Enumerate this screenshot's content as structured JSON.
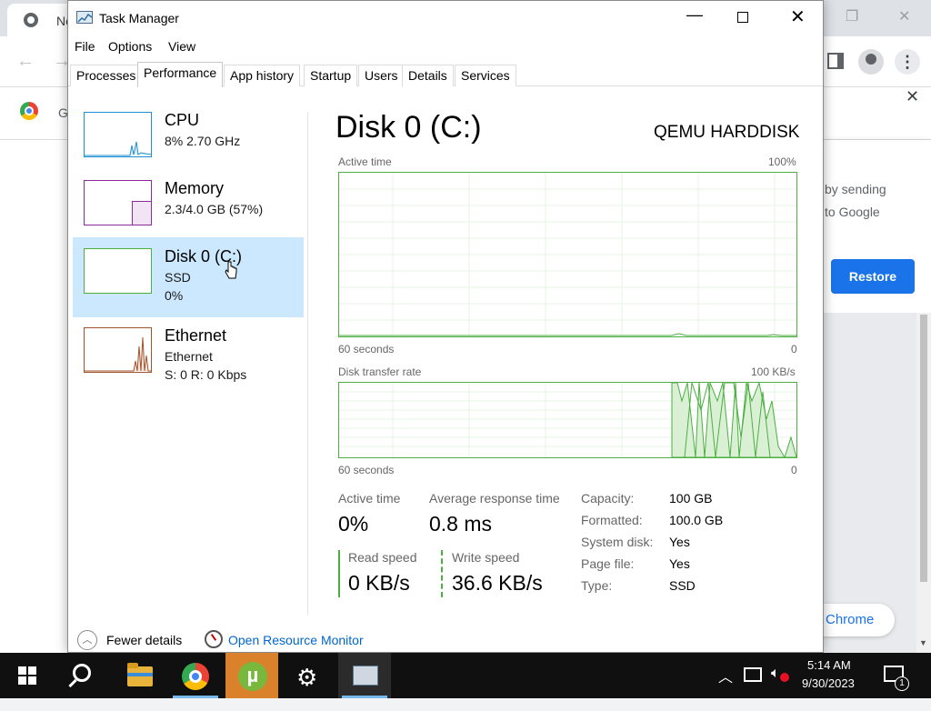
{
  "chrome": {
    "tab_title": "Ne",
    "infobar_text": "G",
    "bubble_line1": "by sending",
    "bubble_line2": "to Google",
    "restore_label": "Restore",
    "chrome_pill": "Chrome"
  },
  "taskmanager": {
    "title": "Task Manager",
    "menu": [
      "File",
      "Options",
      "View"
    ],
    "tabs": [
      "Processes",
      "Performance",
      "App history",
      "Startup",
      "Users",
      "Details",
      "Services"
    ],
    "active_tab": "Performance",
    "resources": [
      {
        "name": "CPU",
        "sub1": "8%  2.70 GHz",
        "sub2": ""
      },
      {
        "name": "Memory",
        "sub1": "2.3/4.0 GB (57%)",
        "sub2": ""
      },
      {
        "name": "Disk 0 (C:)",
        "sub1": "SSD",
        "sub2": "0%"
      },
      {
        "name": "Ethernet",
        "sub1": "Ethernet",
        "sub2": "S: 0  R: 0 Kbps"
      }
    ],
    "detail": {
      "title": "Disk 0 (C:)",
      "model": "QEMU HARDDISK",
      "graph1_label": "Active time",
      "graph1_max": "100%",
      "graph1_time": "60 seconds",
      "graph1_min": "0",
      "graph2_label": "Disk transfer rate",
      "graph2_max": "100 KB/s",
      "graph2_time": "60 seconds",
      "graph2_min": "0",
      "active_time_label": "Active time",
      "active_time_value": "0%",
      "avg_response_label": "Average response time",
      "avg_response_value": "0.8 ms",
      "read_speed_label": "Read speed",
      "read_speed_value": "0 KB/s",
      "write_speed_label": "Write speed",
      "write_speed_value": "36.6 KB/s",
      "props": [
        {
          "label": "Capacity:",
          "value": "100 GB"
        },
        {
          "label": "Formatted:",
          "value": "100.0 GB"
        },
        {
          "label": "System disk:",
          "value": "Yes"
        },
        {
          "label": "Page file:",
          "value": "Yes"
        },
        {
          "label": "Type:",
          "value": "SSD"
        }
      ]
    },
    "footer": {
      "fewer_details": "Fewer details",
      "resource_monitor": "Open Resource Monitor"
    }
  },
  "taskbar": {
    "time": "5:14 AM",
    "date": "9/30/2023",
    "notification_count": "1"
  },
  "colors": {
    "disk_green": "#4dae42",
    "cpu_blue": "#1f8fd1",
    "memory_purple": "#8b2a9b",
    "ethernet_orange": "#a0522d",
    "selection": "#cce8ff"
  }
}
